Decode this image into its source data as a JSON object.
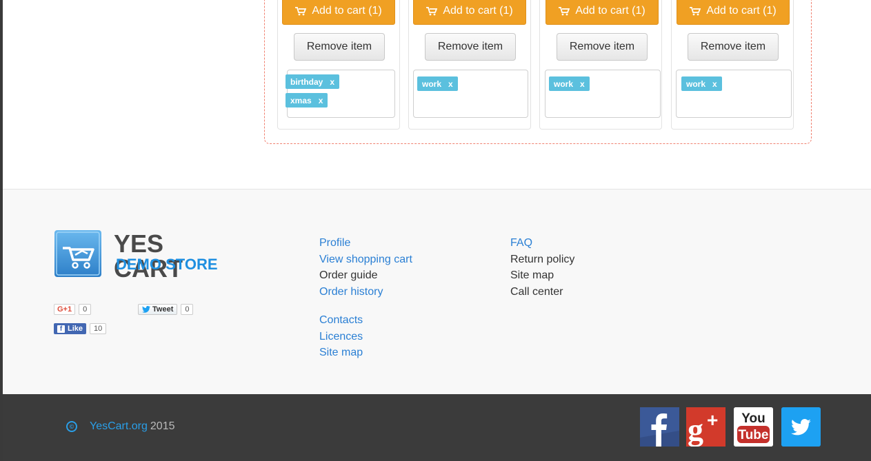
{
  "wishlist": {
    "items": [
      {
        "cart_label": "Add to cart (1)",
        "remove_label": "Remove item",
        "tags": [
          {
            "label": "birthday",
            "x": "x"
          },
          {
            "label": "xmas",
            "x": "x"
          }
        ]
      },
      {
        "cart_label": "Add to cart (1)",
        "remove_label": "Remove item",
        "tags": [
          {
            "label": "work",
            "x": "x"
          }
        ]
      },
      {
        "cart_label": "Add to cart (1)",
        "remove_label": "Remove item",
        "tags": [
          {
            "label": "work",
            "x": "x"
          }
        ]
      },
      {
        "cart_label": "Add to cart (1)",
        "remove_label": "Remove item",
        "tags": [
          {
            "label": "work",
            "x": "x"
          }
        ]
      }
    ]
  },
  "footer": {
    "logo": {
      "title": "YES CART",
      "subtitle": "DEMO STORE"
    },
    "social": {
      "gplus": {
        "label": "G+1",
        "count": "0"
      },
      "tweet": {
        "label": "Tweet",
        "count": "0"
      },
      "like": {
        "label": "Like",
        "count": "10"
      }
    },
    "col1": [
      "Profile",
      "View shopping cart",
      "Order guide",
      "Order history"
    ],
    "col1b": [
      "Contacts",
      "Licences",
      "Site map"
    ],
    "col2": [
      "FAQ",
      "Return policy",
      "Site map",
      "Call center"
    ]
  },
  "bottom": {
    "copyright_symbol": "©",
    "site": "YesCart.org",
    "year": "2015",
    "icons": [
      "facebook-icon",
      "google-plus-icon",
      "youtube-icon",
      "twitter-icon"
    ],
    "colors": {
      "facebook": "#3b5998",
      "gplus": "#d23a2b",
      "youtube": "#c4302b",
      "twitter": "#1da1f2"
    }
  }
}
